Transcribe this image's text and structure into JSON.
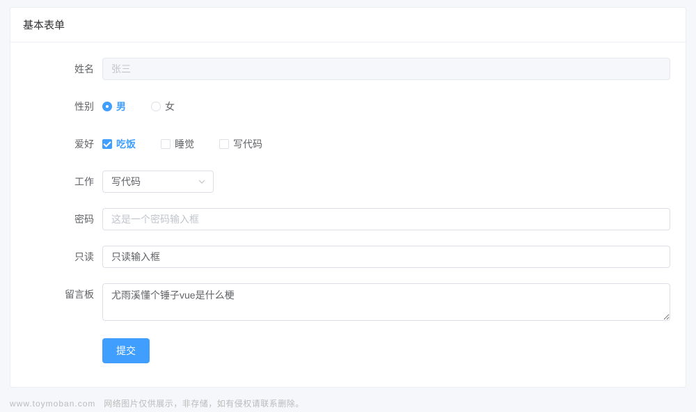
{
  "card": {
    "title": "基本表单"
  },
  "form": {
    "name": {
      "label": "姓名",
      "placeholder": "张三",
      "value": ""
    },
    "gender": {
      "label": "性别",
      "options": [
        {
          "label": "男",
          "checked": true
        },
        {
          "label": "女",
          "checked": false
        }
      ]
    },
    "hobby": {
      "label": "爱好",
      "options": [
        {
          "label": "吃饭",
          "checked": true
        },
        {
          "label": "睡觉",
          "checked": false
        },
        {
          "label": "写代码",
          "checked": false
        }
      ]
    },
    "job": {
      "label": "工作",
      "selected": "写代码"
    },
    "password": {
      "label": "密码",
      "placeholder": "这是一个密码输入框",
      "value": ""
    },
    "readonly": {
      "label": "只读",
      "value": "只读输入框"
    },
    "message": {
      "label": "留言板",
      "value": "尤雨溪懂个锤子vue是什么梗"
    },
    "submit_label": "提交"
  },
  "footer": {
    "domain": "www.toymoban.com",
    "notice": "网络图片仅供展示，非存储，如有侵权请联系删除。"
  }
}
